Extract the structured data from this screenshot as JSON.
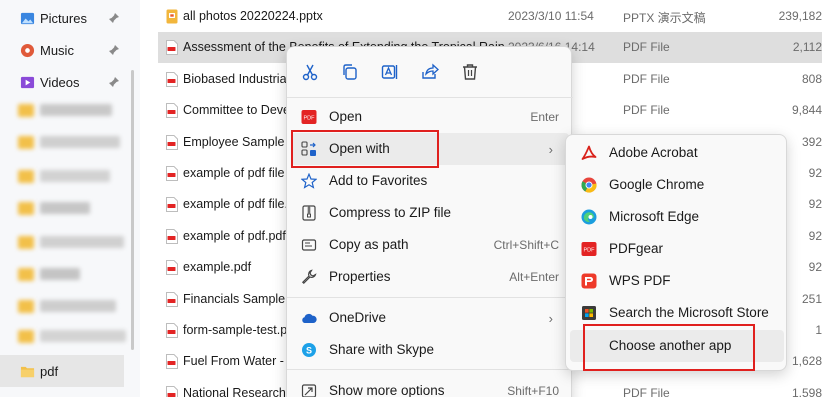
{
  "sidebar": {
    "items": [
      {
        "label": "Pictures",
        "icon": "pictures-icon",
        "color": "#3a86e0"
      },
      {
        "label": "Music",
        "icon": "music-icon",
        "color": "#e05a3a"
      },
      {
        "label": "Videos",
        "icon": "videos-icon",
        "color": "#8a4ad8"
      }
    ],
    "selected": {
      "label": "pdf",
      "icon": "folder-icon",
      "color": "#f2c04a"
    }
  },
  "files": [
    {
      "name": "all photos 20220224.pptx",
      "date": "2023/3/10 11:54",
      "type": "PPTX 演示文稿",
      "size": "239,182",
      "icon": "pptx-icon"
    },
    {
      "name": "Assessment of the Benefits of Extending the Tropical Rain...",
      "date": "2023/6/16 14:14",
      "type": "PDF File",
      "size": "2,112",
      "icon": "pdf-file-icon",
      "selected": true
    },
    {
      "name": "Biobased Industrial",
      "date": "1:10",
      "type": "PDF File",
      "size": "808",
      "icon": "pdf-file-icon"
    },
    {
      "name": "Committee to Deve",
      "date": "0:00",
      "type": "PDF File",
      "size": "9,844",
      "icon": "pdf-file-icon"
    },
    {
      "name": "Employee Sample D",
      "date": "",
      "type": "",
      "size": "392",
      "icon": "pdf-file-icon"
    },
    {
      "name": "example of pdf file",
      "date": "",
      "type": "",
      "size": "92",
      "icon": "pdf-file-icon"
    },
    {
      "name": "example of pdf file.",
      "date": "",
      "type": "",
      "size": "92",
      "icon": "pdf-file-icon"
    },
    {
      "name": "example of pdf.pdf",
      "date": "",
      "type": "",
      "size": "92",
      "icon": "pdf-file-icon"
    },
    {
      "name": "example.pdf",
      "date": "",
      "type": "",
      "size": "92",
      "icon": "pdf-file-icon"
    },
    {
      "name": "Financials Sample D",
      "date": "",
      "type": "",
      "size": "251",
      "icon": "pdf-file-icon"
    },
    {
      "name": "form-sample-test.p",
      "date": "",
      "type": "",
      "size": "1",
      "icon": "pdf-file-icon"
    },
    {
      "name": "Fuel From Water - ",
      "date": "",
      "type": "",
      "size": "1,628",
      "icon": "pdf-file-icon"
    },
    {
      "name": "National Research C",
      "date": "",
      "type": "PDF File",
      "size": "1,598",
      "icon": "pdf-file-icon"
    }
  ],
  "context_menu": {
    "toolbar": [
      "cut-icon",
      "copy-icon",
      "rename-icon",
      "share-icon",
      "delete-icon"
    ],
    "items": [
      {
        "label": "Open",
        "shortcut": "Enter",
        "icon": "pdfgear-icon"
      },
      {
        "label": "Open with",
        "shortcut": "",
        "icon": "open-with-icon",
        "submenu": true
      },
      {
        "label": "Add to Favorites",
        "shortcut": "",
        "icon": "star-icon"
      },
      {
        "label": "Compress to ZIP file",
        "shortcut": "",
        "icon": "zip-icon"
      },
      {
        "label": "Copy as path",
        "shortcut": "Ctrl+Shift+C",
        "icon": "copy-path-icon"
      },
      {
        "label": "Properties",
        "shortcut": "Alt+Enter",
        "icon": "wrench-icon"
      },
      {
        "label": "OneDrive",
        "shortcut": "",
        "icon": "onedrive-icon",
        "submenu": true
      },
      {
        "label": "Share with Skype",
        "shortcut": "",
        "icon": "skype-icon"
      },
      {
        "label": "Show more options",
        "shortcut": "Shift+F10",
        "icon": "more-options-icon"
      }
    ]
  },
  "submenu": {
    "items": [
      {
        "label": "Adobe Acrobat",
        "icon": "adobe-acrobat-icon"
      },
      {
        "label": "Google Chrome",
        "icon": "chrome-icon"
      },
      {
        "label": "Microsoft Edge",
        "icon": "edge-icon"
      },
      {
        "label": "PDFgear",
        "icon": "pdfgear-icon"
      },
      {
        "label": "WPS PDF",
        "icon": "wps-pdf-icon"
      },
      {
        "label": "Search the Microsoft Store",
        "icon": "store-icon"
      },
      {
        "label": "Choose another app",
        "icon": ""
      }
    ]
  },
  "colors": {
    "highlight_red": "#e0201e",
    "accent_blue": "#0067c0"
  }
}
